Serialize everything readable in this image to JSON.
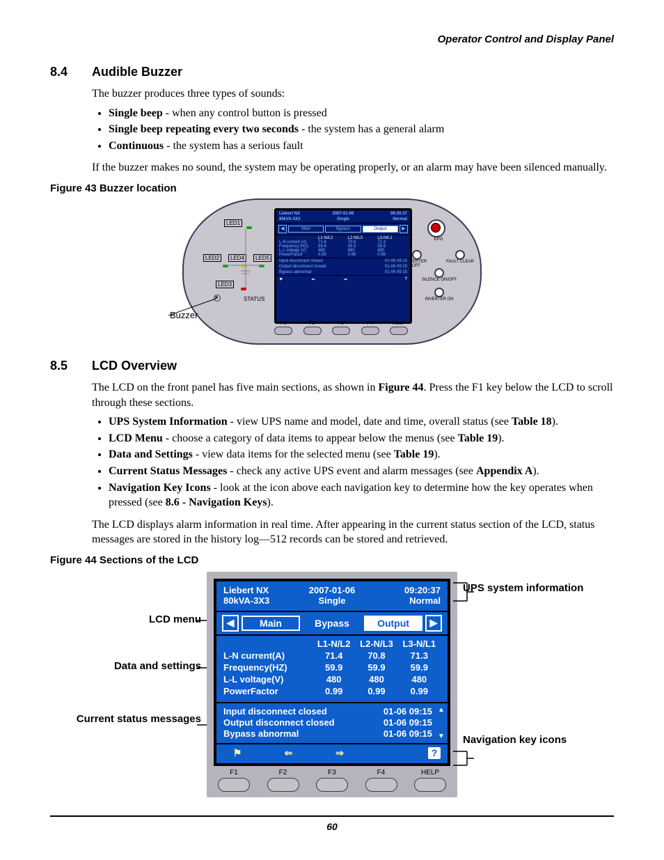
{
  "running_head": "Operator Control and Display Panel",
  "page_number": "60",
  "sec84": {
    "num": "8.4",
    "title": "Audible Buzzer",
    "intro": "The buzzer produces three types of sounds:",
    "bullets": [
      {
        "b": "Single beep",
        "t": " - when any control button is pressed"
      },
      {
        "b": "Single beep repeating every two seconds",
        "t": " - the system has a general alarm"
      },
      {
        "b": "Continuous",
        "t": " - the system has a serious fault"
      }
    ],
    "outro": "If the buzzer makes no sound, the system may be operating properly, or an alarm may have been silenced manually."
  },
  "fig43": {
    "caption": "Figure 43  Buzzer location",
    "buzzer_label": "Buzzer",
    "status_label": "STATUS",
    "leds": {
      "led1": "LED1",
      "led2": "LED2",
      "led3": "LED3",
      "led4": "LED4",
      "led5": "LED5"
    },
    "right": {
      "epo": "EPO",
      "inv_off": "INVERTER OFF",
      "fault": "FAULT CLEAR",
      "silence": "SILENCE ON/OFF",
      "inv_on": "INVERTER ON"
    },
    "lcd": {
      "name": "Liebert NX",
      "model": "80kVA-3X3",
      "date": "2007-01-06",
      "mode": "Single",
      "time": "09:20:37",
      "state": "Normal",
      "tabs": [
        "Main",
        "Bypass",
        "Output"
      ],
      "cols": [
        "L1-N/L2",
        "L2-N/L3",
        "L3-N/L1"
      ],
      "rows": [
        {
          "l": "L-N current (A)",
          "v": [
            "71.4",
            "70.8",
            "71.3"
          ]
        },
        {
          "l": "Frequency (HZ)",
          "v": [
            "59.9",
            "59.9",
            "59.9"
          ]
        },
        {
          "l": "L-L voltage (V)",
          "v": [
            "480",
            "480",
            "480"
          ]
        },
        {
          "l": "PowerFactor",
          "v": [
            "0.99",
            "0.99",
            "0.99"
          ]
        }
      ],
      "msgs": [
        {
          "t": "Input disconnect closed",
          "ts": "01-06 09:15"
        },
        {
          "t": "Output disconnect closed",
          "ts": "01-06 09:15"
        },
        {
          "t": "Bypass abnormal",
          "ts": "01-06 09:15"
        }
      ],
      "fkeys": [
        "F1",
        "F2",
        "F3",
        "F4",
        "HELP"
      ]
    }
  },
  "sec85": {
    "num": "8.5",
    "title": "LCD Overview",
    "p1a": "The LCD on the front panel has five main sections, as shown in ",
    "p1b": "Figure 44",
    "p1c": ". Press the F1 key below the LCD to scroll through these sections.",
    "bullets": [
      {
        "b": "UPS System Information",
        "t": " - view UPS name and model, date and time, overall status (see ",
        "ref": "Table 18",
        "tail": ")."
      },
      {
        "b": "LCD Menu",
        "t": " - choose a category of data items to appear below the menus (see ",
        "ref": "Table 19",
        "tail": ")."
      },
      {
        "b": "Data and Settings",
        "t": " - view data items for the selected menu (see ",
        "ref": "Table 19",
        "tail": ")."
      },
      {
        "b": "Current Status Messages",
        "t": " - check any active UPS event and alarm messages (see ",
        "ref": "Appendix A",
        "tail": ")."
      },
      {
        "b": "Navigation Key Icons",
        "t": " - look at the icon above each navigation key to determine how the key operates when pressed (see ",
        "ref": "8.6 - Navigation Keys",
        "tail": ")."
      }
    ],
    "p2": "The LCD displays alarm information in real time. After appearing in the current status section of the LCD, status messages are stored in the history log—512 records can be stored and retrieved."
  },
  "fig44": {
    "caption": "Figure 44  Sections of the LCD",
    "callouts_left": [
      "LCD menu",
      "Data and settings",
      "Current status messages"
    ],
    "callouts_right": [
      "UPS system information",
      "Navigation key icons"
    ],
    "lcd": {
      "name": "Liebert NX",
      "model": "80kVA-3X3",
      "date": "2007-01-06",
      "mode": "Single",
      "time": "09:20:37",
      "state": "Normal",
      "tabs": {
        "main": "Main",
        "bypass": "Bypass",
        "output": "Output"
      },
      "cols": [
        "L1-N/L2",
        "L2-N/L3",
        "L3-N/L1"
      ],
      "rows": [
        {
          "l": "L-N current(A)",
          "v": [
            "71.4",
            "70.8",
            "71.3"
          ]
        },
        {
          "l": "Frequency(HZ)",
          "v": [
            "59.9",
            "59.9",
            "59.9"
          ]
        },
        {
          "l": "L-L voltage(V)",
          "v": [
            "480",
            "480",
            "480"
          ]
        },
        {
          "l": "PowerFactor",
          "v": [
            "0.99",
            "0.99",
            "0.99"
          ]
        }
      ],
      "msgs": [
        {
          "t": "Input disconnect closed",
          "ts": "01-06 09:15"
        },
        {
          "t": "Output disconnect closed",
          "ts": "01-06 09:15"
        },
        {
          "t": "Bypass abnormal",
          "ts": "01-06 09:15"
        }
      ],
      "nav_icons": [
        "⚑",
        "⇐",
        "⇒",
        "",
        "?"
      ],
      "fkeys": [
        "F1",
        "F2",
        "F3",
        "F4",
        "HELP"
      ]
    }
  }
}
